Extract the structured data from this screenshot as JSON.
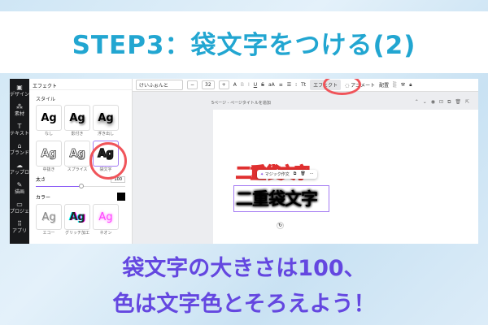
{
  "title": "STEP3：袋文字をつける(2)",
  "sidebar": [
    "デザイン",
    "素材",
    "テキスト",
    "ブランド",
    "アップロード",
    "描画",
    "プロジェクト",
    "アプリ"
  ],
  "panel": {
    "header": "エフェクト",
    "style_label": "スタイル",
    "styles": [
      {
        "sample": "Ag",
        "label": "なし"
      },
      {
        "sample": "Ag",
        "label": "影付き"
      },
      {
        "sample": "Ag",
        "label": "浮き出し"
      },
      {
        "sample": "Ag",
        "label": "中抜き"
      },
      {
        "sample": "Ag",
        "label": "スプライス"
      },
      {
        "sample": "Ag",
        "label": "袋文字"
      }
    ],
    "thickness_label": "太さ",
    "thickness_value": "100",
    "color_label": "カラー",
    "color": "#000000",
    "more_styles": [
      {
        "sample": "Ag",
        "label": "エコー"
      },
      {
        "sample": "Ag",
        "label": "グリッチ加工"
      },
      {
        "sample": "Ag",
        "label": "ネオン"
      }
    ]
  },
  "toolbar": {
    "font": "けいふぉんと",
    "size": "32",
    "minus": "−",
    "plus": "+",
    "effect": "エフェクト",
    "animate": "アニメート",
    "position": "配置"
  },
  "canvas": {
    "page_title": "5ページ - ページタイトルを追加",
    "text1": "二重袋文字",
    "text2": "二重袋文字",
    "popup_magic": "マジック作文",
    "popup_more": "⋯"
  },
  "message": {
    "line1": "袋文字の大きさは100、",
    "line2": "色は文字色とそろえよう！"
  }
}
